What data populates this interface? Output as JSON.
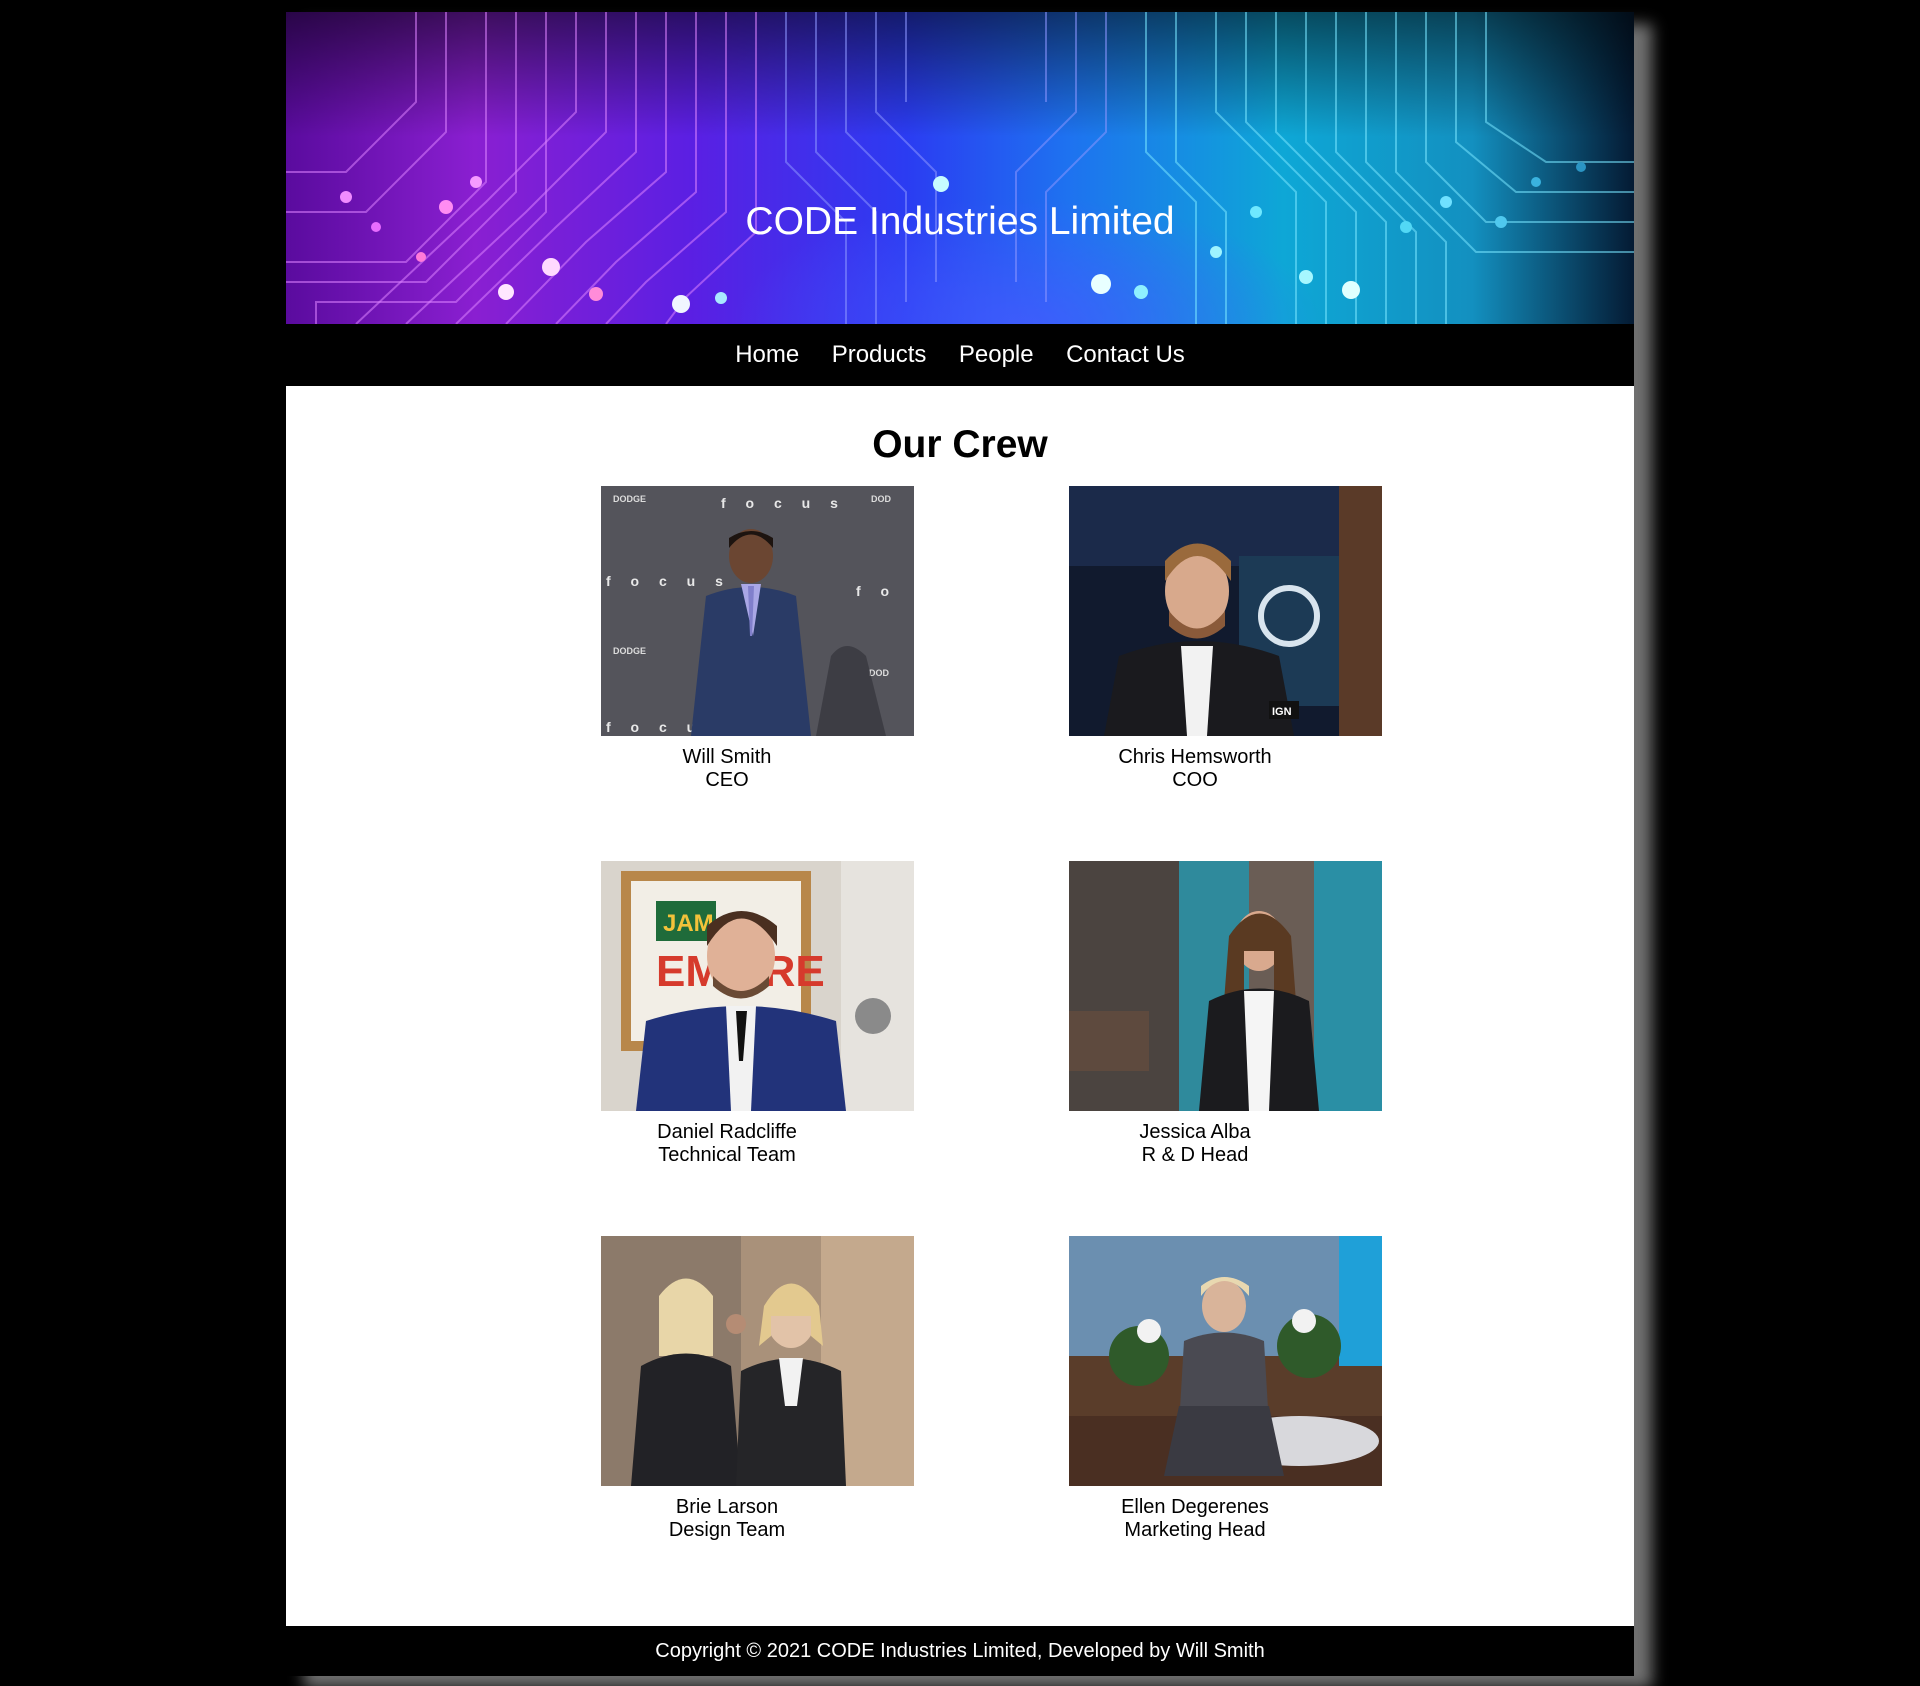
{
  "site": {
    "title": "CODE Industries Limited"
  },
  "nav": {
    "items": [
      {
        "label": "Home"
      },
      {
        "label": "Products"
      },
      {
        "label": "People"
      },
      {
        "label": "Contact Us"
      }
    ]
  },
  "main": {
    "heading": "Our Crew",
    "members": [
      {
        "name": "Will Smith",
        "role": "CEO",
        "photo": "will-smith-photo"
      },
      {
        "name": "Chris Hemsworth",
        "role": "COO",
        "photo": "chris-hemsworth-photo"
      },
      {
        "name": "Daniel Radcliffe",
        "role": "Technical Team",
        "photo": "daniel-radcliffe-photo"
      },
      {
        "name": "Jessica Alba",
        "role": "R & D Head",
        "photo": "jessica-alba-photo"
      },
      {
        "name": "Brie Larson",
        "role": "Design Team",
        "photo": "brie-larson-photo"
      },
      {
        "name": "Ellen Degerenes",
        "role": "Marketing Head",
        "photo": "ellen-degerenes-photo"
      }
    ]
  },
  "footer": {
    "text": "Copyright © 2021 CODE Industries Limited, Developed by Will Smith"
  },
  "colors": {
    "page_background": "#000000",
    "content_background": "#ffffff",
    "header_gradient_start": "#8a1fd1",
    "header_gradient_end": "#0ea7d6"
  }
}
